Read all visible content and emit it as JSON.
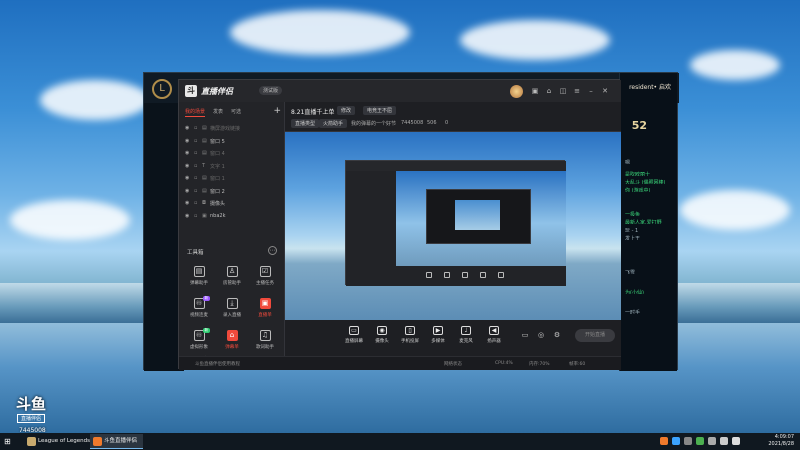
{
  "app": {
    "title": "直播伴侣",
    "version": "测试版",
    "tabs": [
      "我的场景",
      "发表",
      "可选",
      "未选"
    ],
    "scenes": [
      {
        "name": "横屏游戏链接",
        "dim": true
      },
      {
        "name": "窗口 5",
        "dim": false
      },
      {
        "name": "窗口 4",
        "dim": true
      },
      {
        "name": "文字 1",
        "dim": true
      },
      {
        "name": "窗口 1",
        "dim": true
      },
      {
        "name": "窗口 2",
        "dim": false
      },
      {
        "name": "摄像头",
        "dim": false
      },
      {
        "name": "nba2k",
        "dim": false
      }
    ],
    "toolbox": {
      "heading": "工具箱",
      "more": "⋯",
      "tools": [
        {
          "label": "弹幕助手",
          "icon": "▤",
          "badge": ""
        },
        {
          "label": "房管助手",
          "icon": "♙",
          "badge": ""
        },
        {
          "label": "主播任务",
          "icon": "☑",
          "badge": ""
        },
        {
          "label": "视频连麦",
          "icon": "♾",
          "badge": "新"
        },
        {
          "label": "录入直播",
          "icon": "⤓",
          "badge": ""
        },
        {
          "label": "直播单",
          "icon": "▣",
          "badge": "",
          "red": true
        },
        {
          "label": "虚拟形象",
          "icon": "♾",
          "badge": "新"
        },
        {
          "label": "弹幕单",
          "icon": "⌂",
          "badge": "",
          "red_label": true
        },
        {
          "label": "歌词助手",
          "icon": "♫",
          "badge": ""
        },
        {
          "label": "",
          "icon": "▤",
          "badge": "新"
        },
        {
          "label": "",
          "icon": "⋀",
          "badge": ""
        },
        {
          "label": "",
          "icon": "⌂",
          "badge": ""
        }
      ]
    },
    "notice": "斗鱼直播伴侣使用教程",
    "room_title": "8.21直播千上单",
    "chips": [
      "修改",
      "电竞王不屈",
      "直播类型",
      "火箭助手"
    ],
    "room_info": [
      "我的弹幕的一个好节",
      "7445008",
      "506",
      "0"
    ],
    "controls": [
      "直播屏幕",
      "摄像头",
      "手机投屏",
      "多媒体",
      "麦克风",
      "扬声器"
    ],
    "start_button": "开始直播",
    "status": [
      "网络状态",
      "CPU:4%",
      "内存:70%",
      "帧率:60"
    ]
  },
  "lol": {
    "user": "resident• 启欢",
    "number": "52",
    "chat": [
      "嗯",
      "是吹欧丽士",
      "大乱斗 (偶照网棒)",
      "你 (游戏中)",
      "一极鱼",
      "最新人家,爱打野",
      "玩 - 1",
      "发上王",
      "飞雪",
      "为(小仙)",
      "一时手"
    ]
  },
  "watermark": {
    "logo": "斗鱼",
    "box": "直播伴侣",
    "room": "7445008"
  },
  "taskbar": {
    "tasks": [
      {
        "label": "League of Legends",
        "active": false
      },
      {
        "label": "斗鱼直播伴侣",
        "active": true
      }
    ],
    "time": "4:09:07",
    "date": "2021/8/28"
  },
  "colors": {
    "accent": "#f04a3c",
    "panel": "#1e1f23"
  }
}
